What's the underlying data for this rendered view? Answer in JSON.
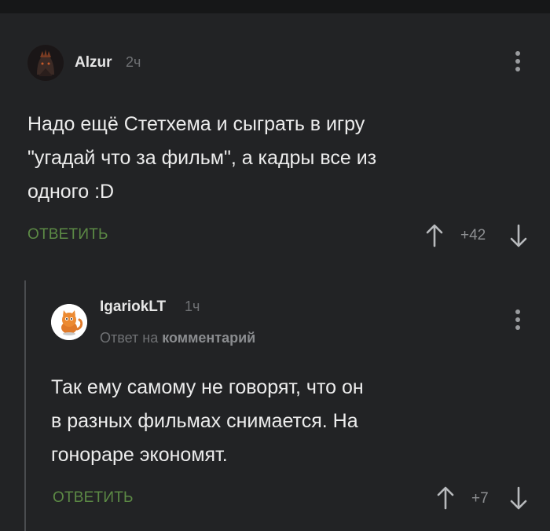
{
  "comments": [
    {
      "author": "Alzur",
      "time": "2ч",
      "text": "Надо ещё Стетхема и сыграть в игру\n\"угадай что за фильм\", а кадры все из\nодного :D",
      "reply_label": "ОТВЕТИТЬ",
      "score": "+42"
    },
    {
      "author": "IgariokLT",
      "time": "1ч",
      "reply_to_prefix": "Ответ на",
      "reply_to_target": "комментарий",
      "text": "Так ему самому не говорят, что он\nв разных фильмах снимается. На\nгонораре экономят.",
      "reply_label": "ОТВЕТИТЬ",
      "score": "+7"
    }
  ],
  "colors": {
    "background": "#222325",
    "accent_green": "#5c8a45",
    "muted": "#6f7174"
  }
}
